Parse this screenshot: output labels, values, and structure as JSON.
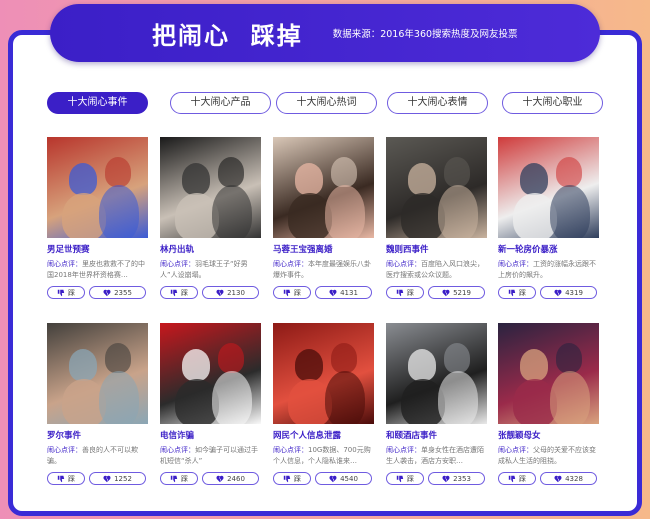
{
  "header": {
    "title": "把闹心  踩掉",
    "source": "数据来源：2016年360搜索热度及网友投票"
  },
  "tabs": [
    {
      "label": "十大闹心事件",
      "active": true
    },
    {
      "label": "十大闹心产品",
      "active": false
    },
    {
      "label": "十大闹心热词",
      "active": false
    },
    {
      "label": "十大闹心表情",
      "active": false
    },
    {
      "label": "十大闹心职业",
      "active": false
    }
  ],
  "labels": {
    "comment": "闹心点评：",
    "dislike": "踩"
  },
  "cards": [
    {
      "title": "男足世预赛",
      "desc": "里皮也救救不了的中国2018年世界杯资格赛…",
      "count": "2355"
    },
    {
      "title": "林丹出轨",
      "desc": "羽毛球王子“好男人”人设崩塌。",
      "count": "2130"
    },
    {
      "title": "马蓉王宝强离婚",
      "desc": "本年度最强娱乐八卦爆炸事件。",
      "count": "4131"
    },
    {
      "title": "魏则西事件",
      "desc": "百度陷入风口浪尖，医疗搜索或公众议题。",
      "count": "5219"
    },
    {
      "title": "新一轮房价暴涨",
      "desc": "工资的涨幅永远跟不上房价的飙升。",
      "count": "4319"
    },
    {
      "title": "罗尔事件",
      "desc": "善良的人不可以欺骗。",
      "count": "1252"
    },
    {
      "title": "电信诈骗",
      "desc": "如今骗子可以通过手机短信“杀人”",
      "count": "2460"
    },
    {
      "title": "网民个人信息泄露",
      "desc": "10G数据、700元购个人信息，个人隐私谁来…",
      "count": "4540"
    },
    {
      "title": "和颐酒店事件",
      "desc": "单身女性在酒店遭陌生人袭击，酒店方安职…",
      "count": "2353"
    },
    {
      "title": "张靓颖母女",
      "desc": "父母的关爱不应该变成私人生活的阻挠。",
      "count": "4328"
    }
  ],
  "colors": {
    "accent": "#3b1fc7",
    "border": "#6f5be0"
  }
}
